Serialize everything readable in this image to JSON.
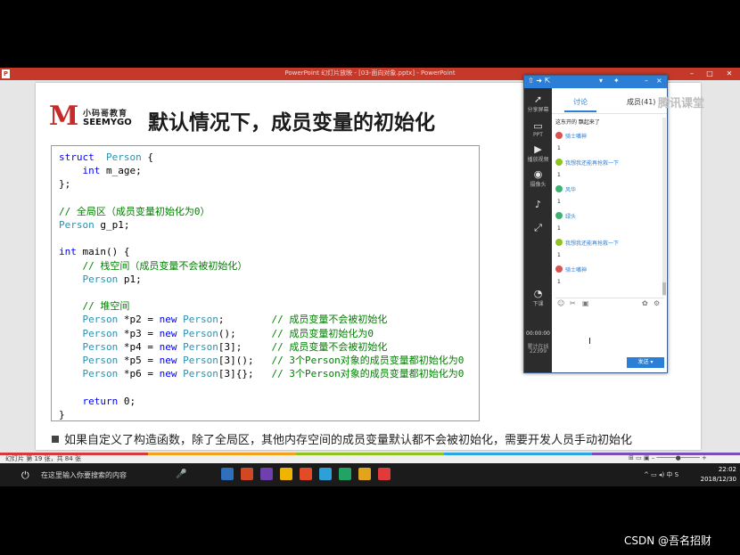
{
  "window": {
    "title": "PowerPoint 幻灯片放映 - [03-面向对象.pptx] - PowerPoint",
    "status": "幻灯片 第 19 张，共 84 张"
  },
  "slide": {
    "logo_cn": "小码哥教育",
    "logo_en": "SEEMYGO",
    "title": "默认情况下，成员变量的初始化",
    "code_lines": [
      [
        [
          "kw",
          "struct"
        ],
        [
          "",
          "  "
        ],
        [
          "ty",
          "Person"
        ],
        [
          "",
          " {"
        ]
      ],
      [
        [
          "",
          "    "
        ],
        [
          "kw",
          "int"
        ],
        [
          "",
          " m_age;"
        ]
      ],
      [
        [
          "",
          "};"
        ]
      ],
      [
        [
          "",
          ""
        ]
      ],
      [
        [
          "cm",
          "// 全局区（成员变量初始化为0）"
        ]
      ],
      [
        [
          "ty",
          "Person"
        ],
        [
          "",
          " g_p1;"
        ]
      ],
      [
        [
          "",
          ""
        ]
      ],
      [
        [
          "kw",
          "int"
        ],
        [
          "",
          " main() {"
        ]
      ],
      [
        [
          "",
          "    "
        ],
        [
          "cm",
          "// 栈空间（成员变量不会被初始化）"
        ]
      ],
      [
        [
          "",
          "    "
        ],
        [
          "ty",
          "Person"
        ],
        [
          "",
          " p1;"
        ]
      ],
      [
        [
          "",
          ""
        ]
      ],
      [
        [
          "",
          "    "
        ],
        [
          "cm",
          "// 堆空间"
        ]
      ],
      [
        [
          "",
          "    "
        ],
        [
          "ty",
          "Person"
        ],
        [
          "",
          " *p2 = "
        ],
        [
          "kw",
          "new"
        ],
        [
          "",
          " "
        ],
        [
          "ty",
          "Person"
        ],
        [
          "",
          ";        "
        ],
        [
          "cm",
          "// 成员变量不会被初始化"
        ]
      ],
      [
        [
          "",
          "    "
        ],
        [
          "ty",
          "Person"
        ],
        [
          "",
          " *p3 = "
        ],
        [
          "kw",
          "new"
        ],
        [
          "",
          " "
        ],
        [
          "ty",
          "Person"
        ],
        [
          "",
          "();      "
        ],
        [
          "cm",
          "// 成员变量初始化为0"
        ]
      ],
      [
        [
          "",
          "    "
        ],
        [
          "ty",
          "Person"
        ],
        [
          "",
          " *p4 = "
        ],
        [
          "kw",
          "new"
        ],
        [
          "",
          " "
        ],
        [
          "ty",
          "Person"
        ],
        [
          "",
          "[3];     "
        ],
        [
          "cm",
          "// 成员变量不会被初始化"
        ]
      ],
      [
        [
          "",
          "    "
        ],
        [
          "ty",
          "Person"
        ],
        [
          "",
          " *p5 = "
        ],
        [
          "kw",
          "new"
        ],
        [
          "",
          " "
        ],
        [
          "ty",
          "Person"
        ],
        [
          "",
          "[3]();   "
        ],
        [
          "cm",
          "// 3个Person对象的成员变量都初始化为0"
        ]
      ],
      [
        [
          "",
          "    "
        ],
        [
          "ty",
          "Person"
        ],
        [
          "",
          " *p6 = "
        ],
        [
          "kw",
          "new"
        ],
        [
          "",
          " "
        ],
        [
          "ty",
          "Person"
        ],
        [
          "",
          "[3]{};   "
        ],
        [
          "cm",
          "// 3个Person对象的成员变量都初始化为0"
        ]
      ],
      [
        [
          "",
          ""
        ]
      ],
      [
        [
          "",
          "    "
        ],
        [
          "kw",
          "return"
        ],
        [
          "",
          " 0;"
        ]
      ],
      [
        [
          "",
          "}"
        ]
      ]
    ],
    "bullet": "如果自定义了构造函数，除了全局区，其他内存空间的成员变量默认都不会被初始化，需要开发人员手动初始化"
  },
  "chat": {
    "sidebar": [
      {
        "icon": "➚",
        "label": "分享屏幕"
      },
      {
        "icon": "▭",
        "label": "PPT"
      },
      {
        "icon": "▶",
        "label": "播放视频"
      },
      {
        "icon": "◉",
        "label": "摄像头"
      },
      {
        "icon": "♪",
        "label": ""
      },
      {
        "icon": "⤢",
        "label": ""
      },
      {
        "icon": "◔",
        "label": "下课"
      }
    ],
    "timer": "00:00:00",
    "online_label": "累计在线",
    "online_count": "22399",
    "tabs": {
      "discuss": "讨论",
      "members": "成员(41)"
    },
    "messages": [
      {
        "name": "",
        "text": "这东开的 飘起来了"
      },
      {
        "name": "骑士嘴神",
        "text": "1",
        "color": "#d9534f"
      },
      {
        "name": "我想我还能再抢救一下",
        "text": "1",
        "color": "#8fc31f"
      },
      {
        "name": "风华",
        "text": "1",
        "color": "#3cb371"
      },
      {
        "name": "绿头",
        "text": "1",
        "color": "#3cb371"
      },
      {
        "name": "我想我还能再抢救一下",
        "text": "1",
        "color": "#8fc31f"
      },
      {
        "name": "骑士嘴神",
        "text": "1",
        "color": "#d9534f"
      }
    ],
    "send": "发送",
    "badge": "腾讯课堂"
  },
  "taskbar": {
    "search": "在这里输入你要搜索的内容",
    "time": "22:02",
    "date": "2018/12/30",
    "apps": [
      "#2e6fbe",
      "#d24726",
      "#6f3fb0",
      "#f0b400",
      "#e34b26",
      "#2d9fd9",
      "#21a366",
      "#e1a41b",
      "#e03a3a"
    ]
  },
  "watermark": "CSDN @吾名招财"
}
